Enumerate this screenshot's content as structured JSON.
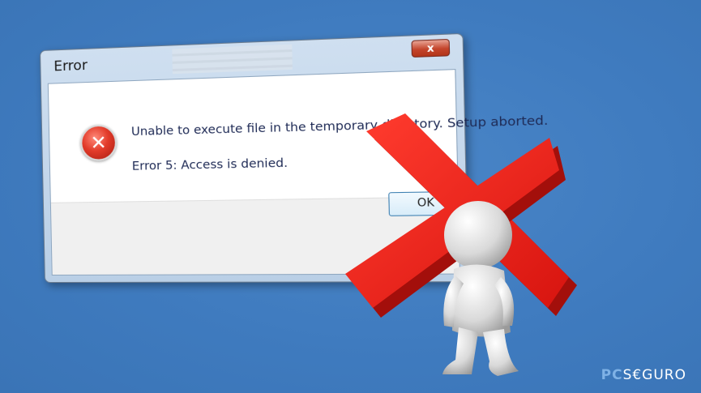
{
  "dialog": {
    "title": "Error",
    "close_glyph": "x",
    "icon": "error-x-icon",
    "message": "Unable to execute file in the temporary directory. Setup aborted.",
    "detail": "Error 5: Access is denied.",
    "ok_label": "OK"
  },
  "overlay": {
    "cross_icon": "red-cross-icon",
    "figure": "3d-person-figure",
    "cross_color": "#e8231e"
  },
  "watermark": {
    "prefix": "PC",
    "suffix": "S€GURO"
  },
  "colors": {
    "background": "#3f7bbf",
    "close_button": "#c4452c"
  }
}
